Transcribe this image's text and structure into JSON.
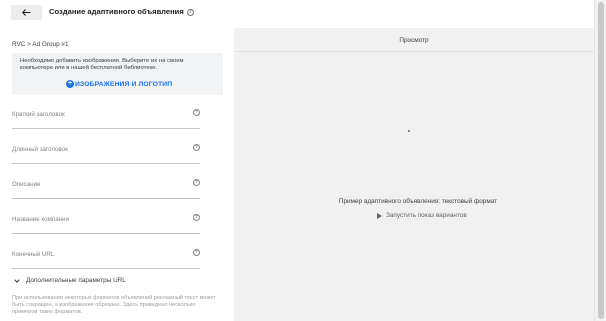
{
  "header": {
    "back_label": "back",
    "title": "Создание адаптивного объявления",
    "help": "?"
  },
  "left": {
    "breadcrumb": "RVC > Ad Group #1",
    "notice": {
      "text": "Необходимо добавить изображения. Выберите их на своем компьютере или в нашей бесплатной библиотеке.",
      "button_icon": "+",
      "button_label": "ИЗОБРАЖЕНИЯ И ЛОГОТИП"
    },
    "fields": [
      {
        "label": "Краткий заголовок",
        "help": "?"
      },
      {
        "label": "Длинный заголовок",
        "help": "?"
      },
      {
        "label": "Описание",
        "help": "?"
      },
      {
        "label": "Название компании",
        "help": "?"
      },
      {
        "label": "Конечный URL",
        "help": "?"
      }
    ],
    "url_options_label": "Дополнительные параметры URL",
    "footnote": "При использовании некоторых форматов объявлений рекламный текст может быть сокращен, а изображение обрезано. Здесь приведено несколько примеров таких форматов."
  },
  "preview": {
    "title": "Просмотр",
    "caption": "Пример адаптивного объявления: текстовый формат",
    "run_label": "Запустить показ вариантов"
  },
  "icons": {
    "back": "arrow-left-icon",
    "help": "question-circle-icon",
    "add": "plus-circle-icon",
    "expand": "chevron-down-icon",
    "play": "play-icon"
  },
  "colors": {
    "accent": "#1a73e8",
    "preview_bg": "#f1f1f1",
    "notice_bg": "#f1f3f4"
  }
}
